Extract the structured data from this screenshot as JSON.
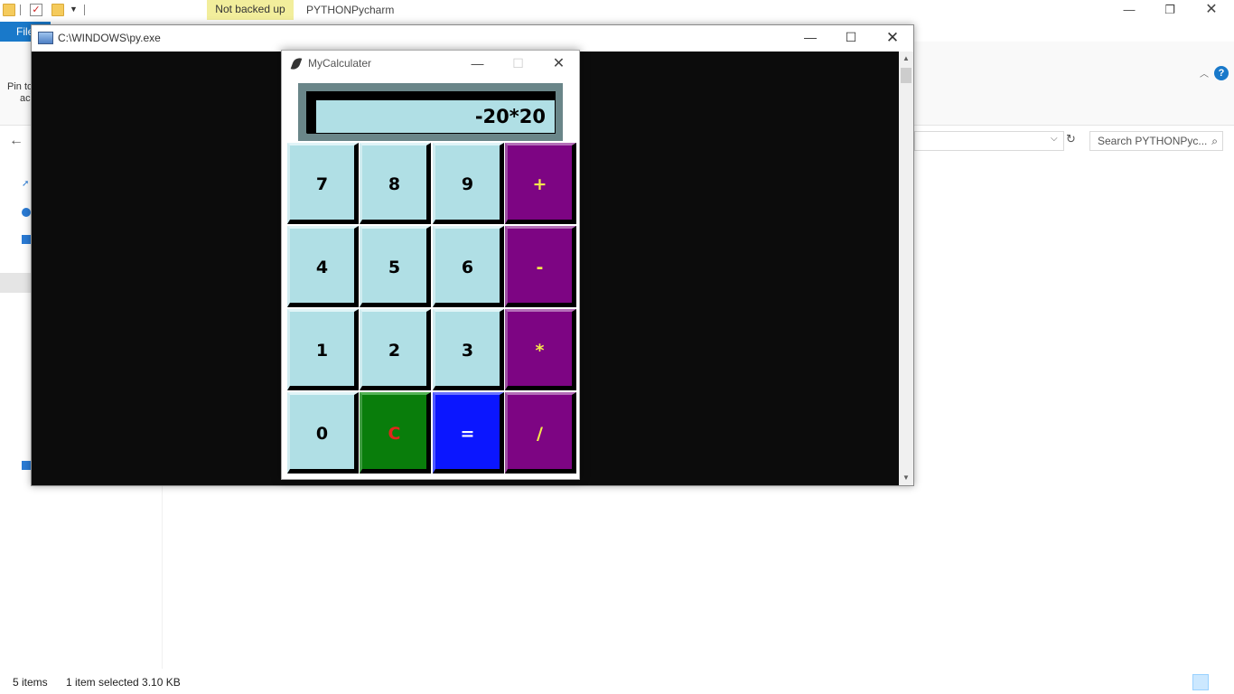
{
  "explorer": {
    "status_badge": "Not backed up",
    "title": "PYTHONPycharm",
    "file_tab": "File",
    "pin_text_line1": "Pin to",
    "pin_text_line2": "ac",
    "search_placeholder": "Search PYTHONPyc...",
    "status_items": "5 items",
    "status_selected": "1 item selected  3.10 KB"
  },
  "console": {
    "title": "C:\\WINDOWS\\py.exe"
  },
  "calculator": {
    "title": "MyCalculater",
    "display": "-20*20",
    "rows": [
      [
        "7",
        "8",
        "9",
        "+"
      ],
      [
        "4",
        "5",
        "6",
        "-"
      ],
      [
        "1",
        "2",
        "3",
        "*"
      ],
      [
        "0",
        "C",
        "=",
        "/"
      ]
    ]
  },
  "colors": {
    "number_key": "#b0dfe5",
    "operator_key": "#7d0583",
    "operator_text": "#f5e94a",
    "clear_key": "#097d0b",
    "clear_text": "#e0261b",
    "equals_key": "#0b16ff",
    "equals_text": "#ffffff",
    "display_frame": "#6a8689",
    "console_bg": "#0c0c0c"
  }
}
